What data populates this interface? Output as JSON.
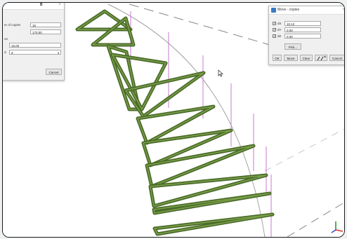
{
  "left_dialog": {
    "header_char": "B",
    "copies_label": "er of copies",
    "copies_value": "15",
    "field2_value": "170,00",
    "field3_label": "on",
    "field3_value": "15.00",
    "axis_label": "d",
    "axis_value": "Z",
    "cancel_label": "Cancel",
    "close_glyph": "×"
  },
  "move_dialog": {
    "title": "Move - copies",
    "close_glyph": "×",
    "rows": [
      {
        "label": "dX",
        "value": "10.12"
      },
      {
        "label": "dY",
        "value": "0.00"
      },
      {
        "label": "dZ",
        "value": "0.00"
      }
    ],
    "pick_label": "Pick...",
    "buttons": {
      "ok": "OK",
      "move": "Move",
      "clear": "Clear",
      "cancel": "Cancel"
    }
  },
  "canvas": {
    "colors": {
      "background": "#ffffff",
      "beam": "#4a6a28",
      "beam_light": "#7aa04a",
      "guide": "#c87ad0",
      "arc": "#a0a0a0"
    },
    "axis_triad_icon": "xyz-axes-icon",
    "cursor_icon": "mouse-pointer-icon"
  }
}
